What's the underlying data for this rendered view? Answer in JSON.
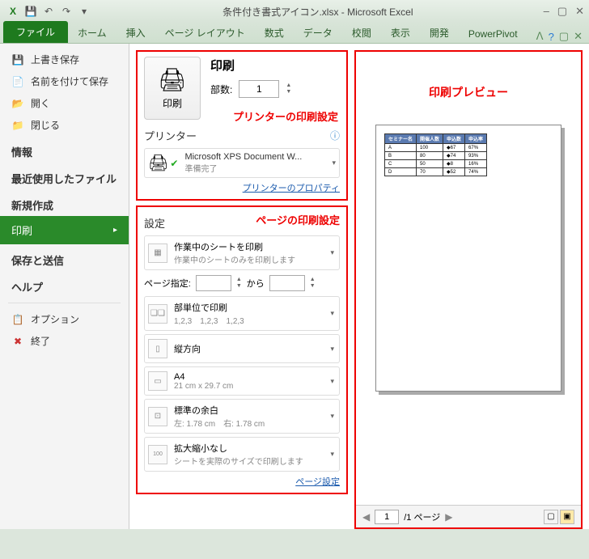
{
  "window": {
    "title": "条件付き書式アイコン.xlsx - Microsoft Excel"
  },
  "ribbon": {
    "file": "ファイル",
    "tabs": [
      "ホーム",
      "挿入",
      "ページ レイアウト",
      "数式",
      "データ",
      "校閲",
      "表示",
      "開発",
      "PowerPivot"
    ]
  },
  "nav": {
    "save": "上書き保存",
    "saveas": "名前を付けて保存",
    "open": "開く",
    "close": "閉じる",
    "info": "情報",
    "recent": "最近使用したファイル",
    "new": "新規作成",
    "print": "印刷",
    "share": "保存と送信",
    "help": "ヘルプ",
    "options": "オプション",
    "exit": "終了"
  },
  "print": {
    "title": "印刷",
    "btn": "印刷",
    "copies_label": "部数:",
    "copies_value": "1",
    "printer_section": "プリンター",
    "printer_name": "Microsoft XPS Document W...",
    "printer_status": "準備完了",
    "printer_props": "プリンターのプロパティ",
    "annotation_printer": "プリンターの印刷設定"
  },
  "settings": {
    "title": "設定",
    "annotation_page": "ページの印刷設定",
    "scope_title": "作業中のシートを印刷",
    "scope_sub": "作業中のシートのみを印刷します",
    "pages_label": "ページ指定:",
    "pages_to": "から",
    "collate_title": "部単位で印刷",
    "collate_sub": "1,2,3　1,2,3　1,2,3",
    "orient": "縦方向",
    "paper_title": "A4",
    "paper_sub": "21 cm x 29.7 cm",
    "margin_title": "標準の余白",
    "margin_sub": "左: 1.78 cm　右: 1.78 cm",
    "scale_title": "拡大縮小なし",
    "scale_sub": "シートを実際のサイズで印刷します",
    "page_setup": "ページ設定"
  },
  "preview": {
    "label": "印刷プレビュー",
    "page_current": "1",
    "page_total": "/1 ページ"
  }
}
